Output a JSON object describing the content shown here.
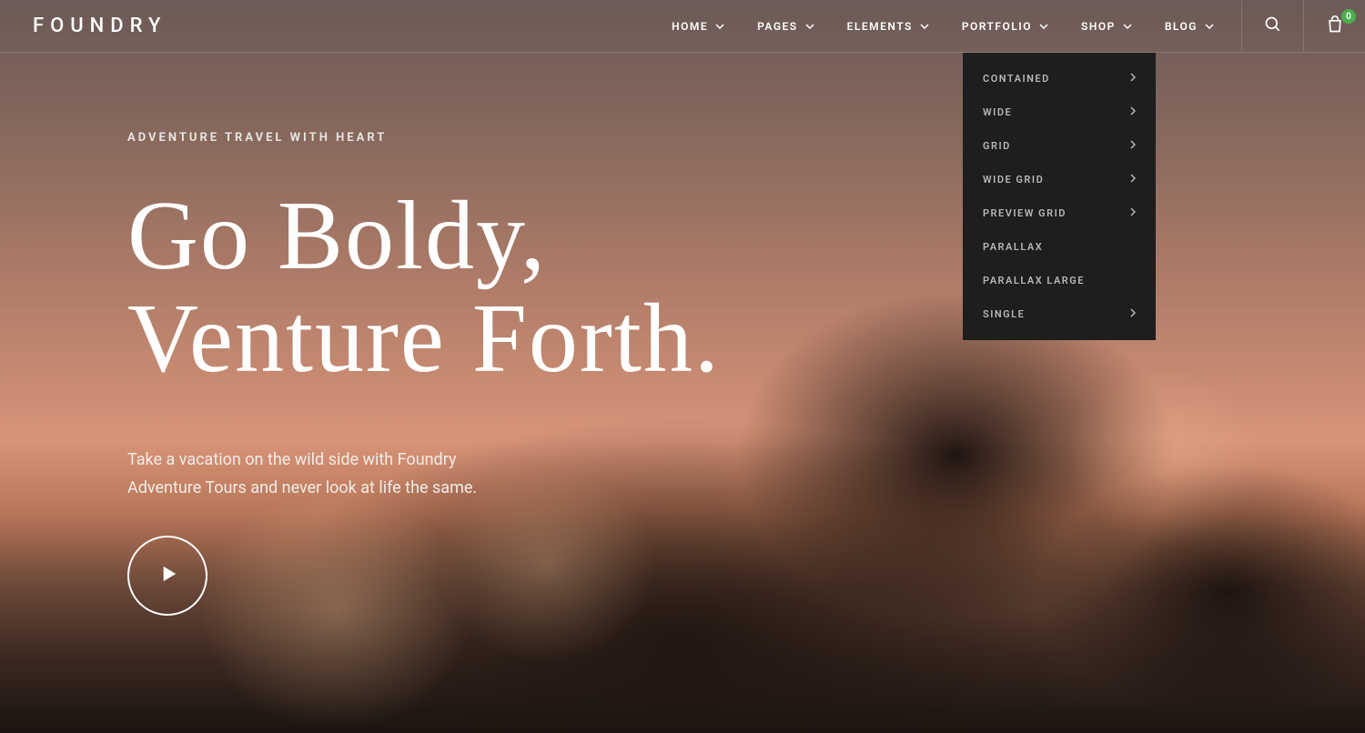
{
  "logo": "FOUNDRY",
  "nav": {
    "items": [
      {
        "label": "HOME",
        "hasDropdown": true
      },
      {
        "label": "PAGES",
        "hasDropdown": true
      },
      {
        "label": "ELEMENTS",
        "hasDropdown": true
      },
      {
        "label": "PORTFOLIO",
        "hasDropdown": true
      },
      {
        "label": "SHOP",
        "hasDropdown": true
      },
      {
        "label": "BLOG",
        "hasDropdown": true
      }
    ],
    "cartBadge": "0"
  },
  "dropdown": {
    "items": [
      {
        "label": "CONTAINED",
        "hasSub": true
      },
      {
        "label": "WIDE",
        "hasSub": true
      },
      {
        "label": "GRID",
        "hasSub": true
      },
      {
        "label": "WIDE GRID",
        "hasSub": true
      },
      {
        "label": "PREVIEW GRID",
        "hasSub": true
      },
      {
        "label": "PARALLAX",
        "hasSub": false
      },
      {
        "label": "PARALLAX LARGE",
        "hasSub": false
      },
      {
        "label": "SINGLE",
        "hasSub": true
      }
    ]
  },
  "hero": {
    "eyebrow": "ADVENTURE TRAVEL WITH HEART",
    "title": "Go Boldy,\nVenture Forth.",
    "sub": "Take a vacation on the wild side with Foundry\nAdventure Tours and never look at life the same."
  }
}
